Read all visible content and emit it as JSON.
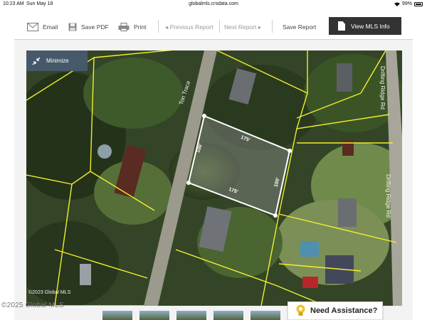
{
  "status_bar": {
    "time": "10:23 AM",
    "date": "Sun May 18",
    "url": "globalmls.crsdata.com",
    "battery": "99%"
  },
  "toolbar": {
    "email_label": "Email",
    "save_pdf_label": "Save PDF",
    "print_label": "Print",
    "previous_report_label": "◂ Previous Report",
    "next_report_label": "Next Report ▸",
    "save_report_label": "Save Report",
    "view_mls_label": "View MLS Info"
  },
  "map": {
    "minimize_label": "Minimize",
    "street_labels": {
      "ton_trace": "Ton Trace",
      "drifting_ridge_top": "Drifting Ridge Rd",
      "drifting_ridge_bottom": "Drifting Ridge Rd"
    },
    "parcel_dimensions": {
      "top": "175'",
      "left": "100'",
      "bottom": "175'",
      "right": "100'"
    },
    "copyright": "©2023 Global MLS",
    "colors": {
      "parcel_lines": "#f2ee2f",
      "subject_outline": "#ffffff"
    }
  },
  "page_copyright": "©2025 Global MLS",
  "assistance": {
    "label": "Need Assistance?"
  }
}
